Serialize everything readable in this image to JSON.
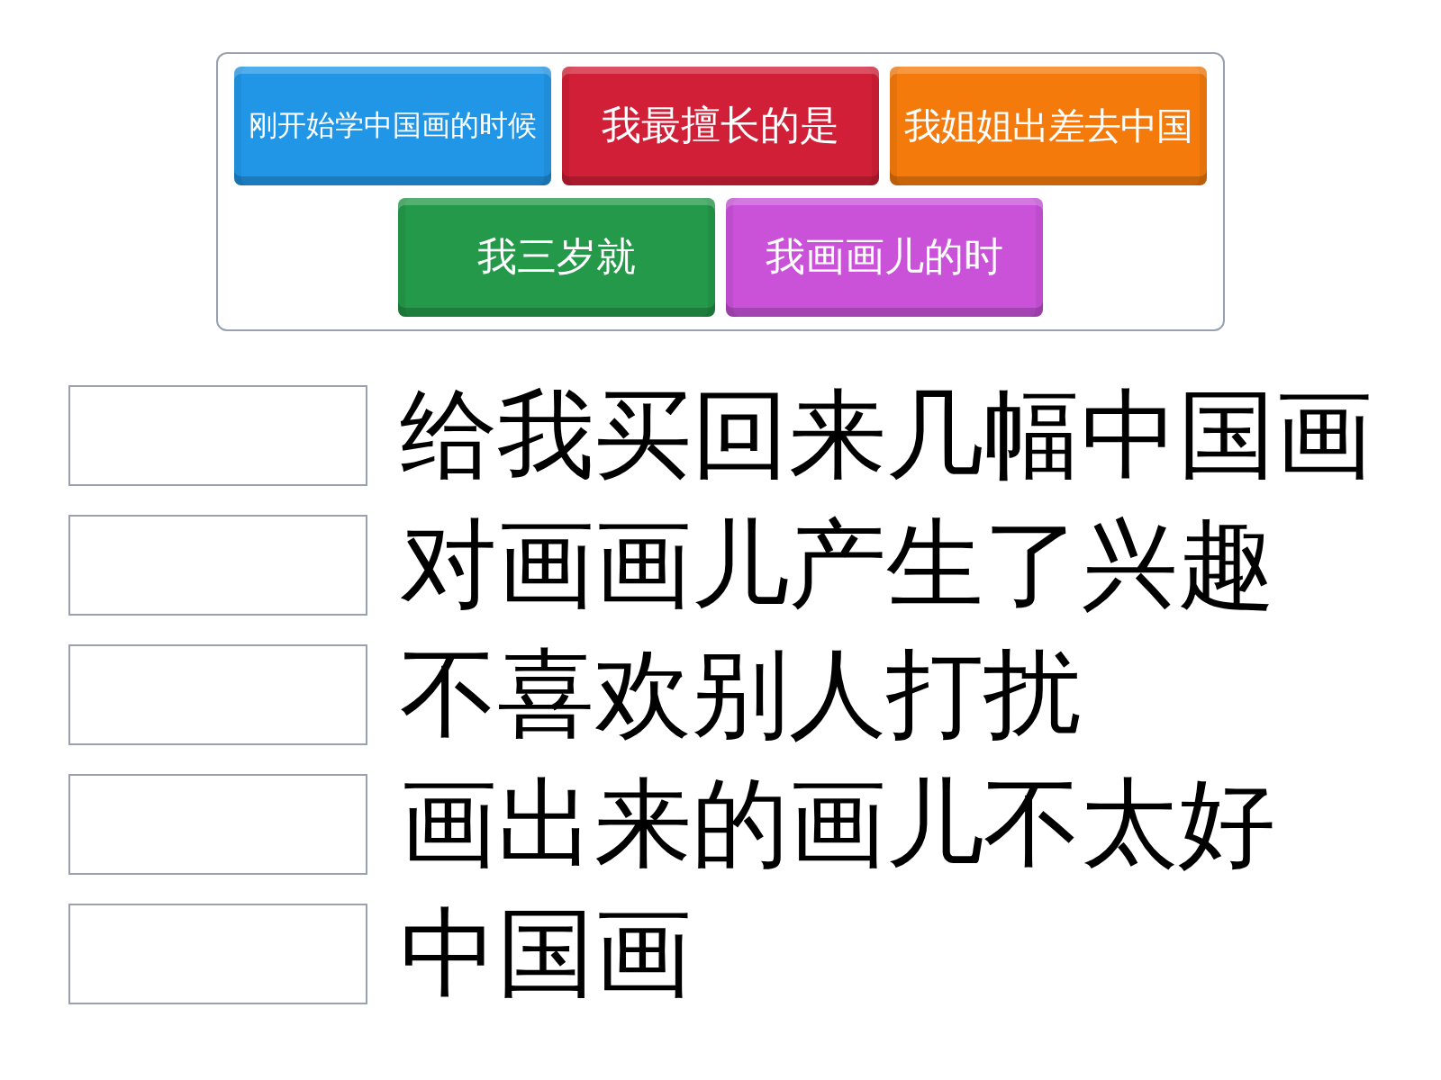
{
  "tiles": [
    {
      "label": "刚开始学中国画的时候",
      "color": "#2196e6"
    },
    {
      "label": "我最擅长的是",
      "color": "#d11f37"
    },
    {
      "label": "我姐姐出差去中国",
      "color": "#f57a0c"
    },
    {
      "label": "我三岁就",
      "color": "#24994a"
    },
    {
      "label": "我画画儿的时",
      "color": "#c952d9"
    }
  ],
  "rows": [
    {
      "text": "给我买回来几幅中国画"
    },
    {
      "text": "对画画儿产生了兴趣"
    },
    {
      "text": "不喜欢别人打扰"
    },
    {
      "text": "画出来的画儿不太好"
    },
    {
      "text": "中国画"
    }
  ]
}
